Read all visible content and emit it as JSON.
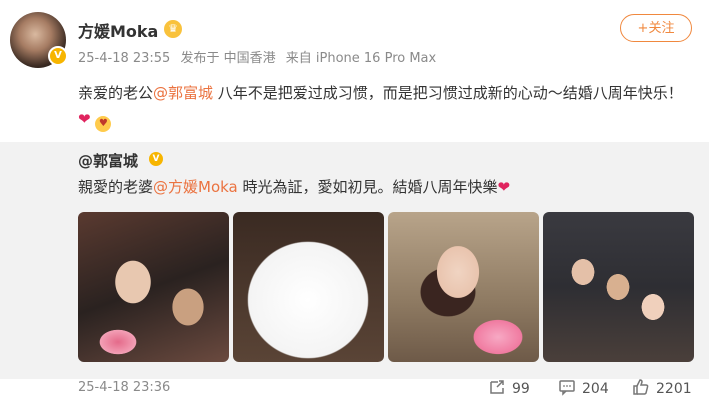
{
  "header": {
    "username": "方媛Moka",
    "meta": {
      "time": "25-4-18 23:55",
      "location": "发布于 中国香港",
      "source": "来自 iPhone 16 Pro Max"
    },
    "follow_label": "+关注"
  },
  "post": {
    "text_before": "亲爱的老公",
    "mention": "@郭富城",
    "text_after": " 八年不是把爱过成习惯，而是把习惯过成新的心动～结婚八周年快乐！"
  },
  "repost": {
    "username": "@郭富城",
    "text_before": "親愛的老婆",
    "mention": "@方媛Moka",
    "text_after": " 時光為証，愛如初見。結婚八周年快樂",
    "photos": [
      "couple-selfie",
      "anniversary-cake",
      "woman-with-flowers",
      "group-photo"
    ],
    "time": "25-4-18 23:36"
  },
  "actions": {
    "repost_count": "99",
    "comment_count": "204",
    "like_count": "2201"
  },
  "colors": {
    "accent": "#eb7340",
    "verified": "#f7b500",
    "repost_bg": "#f2f2f2"
  }
}
